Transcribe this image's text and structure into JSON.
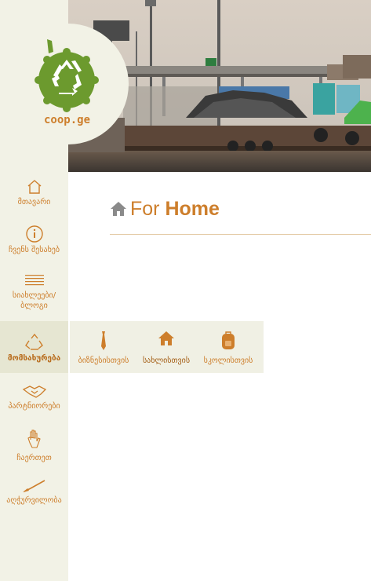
{
  "brand": {
    "logo_text": "coop.ge"
  },
  "nav": {
    "items": [
      {
        "label": "მთავარი",
        "icon": "home-icon"
      },
      {
        "label": "ჩვენს შესახებ",
        "icon": "info-icon"
      },
      {
        "label": "სიახლეები/ ბლოგი",
        "icon": "list-icon"
      },
      {
        "label": "მომსახურება",
        "icon": "recycle-icon",
        "active": true
      },
      {
        "label": "პარტნიორები",
        "icon": "handshake-icon"
      },
      {
        "label": "ჩაერთეთ",
        "icon": "hand-icon"
      },
      {
        "label": "აღჭურვილობა",
        "icon": "brush-icon"
      }
    ]
  },
  "main": {
    "heading_prefix": "For",
    "heading_bold": "Home"
  },
  "submenu": {
    "items": [
      {
        "label": "ბიზნესისთვის",
        "icon": "tie-icon"
      },
      {
        "label": "სახლისთვის",
        "icon": "home-icon",
        "active": true
      },
      {
        "label": "სკოლისთვის",
        "icon": "backpack-icon"
      }
    ]
  },
  "colors": {
    "accent": "#cd7e2b",
    "logo_green": "#6c9a2e",
    "sidebar_bg": "#f2f2e6"
  }
}
